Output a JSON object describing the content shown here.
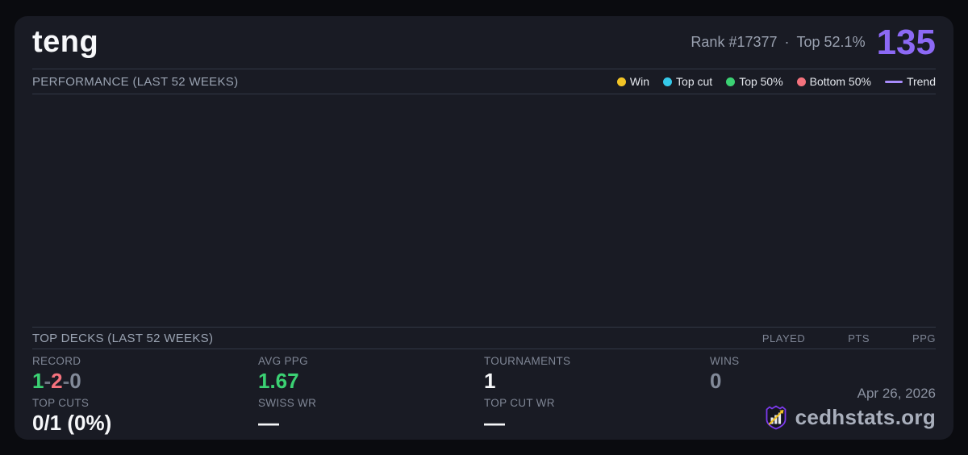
{
  "header": {
    "player_name": "teng",
    "rank_text": "Rank #17377",
    "separator": "·",
    "top_percent_text": "Top 52.1%",
    "points": "135"
  },
  "performance": {
    "title": "PERFORMANCE (LAST 52 WEEKS)",
    "legend": [
      {
        "label": "Win",
        "color": "#f2c426",
        "swatch": "dot"
      },
      {
        "label": "Top cut",
        "color": "#35c9e9",
        "swatch": "dot"
      },
      {
        "label": "Top 50%",
        "color": "#3bd173",
        "swatch": "dot"
      },
      {
        "label": "Bottom 50%",
        "color": "#f4727d",
        "swatch": "dot"
      },
      {
        "label": "Trend",
        "color": "#a78bfa",
        "swatch": "line"
      }
    ],
    "chart_note": "empty plot area - no data points rendered"
  },
  "top_decks": {
    "title": "TOP DECKS (LAST 52 WEEKS)",
    "columns": [
      "PLAYED",
      "PTS",
      "PPG"
    ],
    "rows": []
  },
  "stats": {
    "record": {
      "label": "RECORD",
      "wins": "1",
      "losses": "2",
      "draws": "0",
      "separator": "-"
    },
    "avg_ppg": {
      "label": "AVG PPG",
      "value": "1.67"
    },
    "tournaments": {
      "label": "TOURNAMENTS",
      "value": "1"
    },
    "wins": {
      "label": "WINS",
      "value": "0"
    },
    "top_cuts": {
      "label": "TOP CUTS",
      "value": "0/1 (0%)"
    },
    "swiss_wr": {
      "label": "SWISS WR",
      "value": "—"
    },
    "top_cut_wr": {
      "label": "TOP CUT WR",
      "value": "—"
    }
  },
  "footer": {
    "date": "Apr 26, 2026",
    "brand": "cedhstats.org",
    "logo_icon": "shield-bar-chart-logo"
  },
  "colors": {
    "background": "#0a0b0f",
    "card": "#191b24",
    "divider": "#323846",
    "accent_purple": "#8c69f5",
    "trend_purple": "#a78bfa",
    "win_yellow": "#f2c426",
    "top_cut_cyan": "#35c9e9",
    "positive_green": "#3bd173",
    "negative_red": "#f4727d",
    "muted_gray": "#99a0af"
  }
}
